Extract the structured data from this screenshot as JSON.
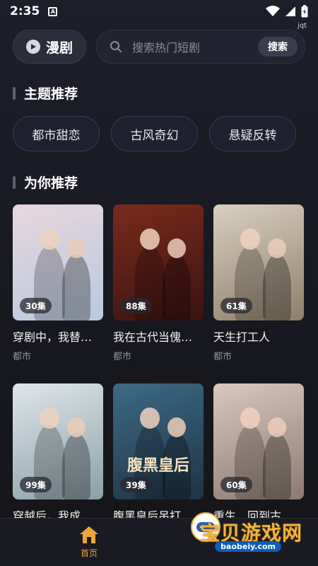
{
  "status": {
    "time": "2:35",
    "app_icon_letter": "A",
    "tag": "jqt"
  },
  "header": {
    "tab_label": "漫剧",
    "search_placeholder": "搜索热门短剧",
    "search_button": "搜索"
  },
  "themes": {
    "title": "主题推荐",
    "items": [
      "都市甜恋",
      "古风奇幻",
      "悬疑反转"
    ]
  },
  "recommend": {
    "title": "为你推荐",
    "items": [
      {
        "episodes": "30集",
        "title": "穿剧中，我替…",
        "tag": "都市",
        "caption": "",
        "palette": [
          "#e7d7de",
          "#b9c9e0"
        ]
      },
      {
        "episodes": "88集",
        "title": "我在古代当傀…",
        "tag": "都市",
        "caption": "",
        "palette": [
          "#7a2a1d",
          "#3a1410"
        ]
      },
      {
        "episodes": "61集",
        "title": "天生打工人",
        "tag": "都市",
        "caption": "",
        "palette": [
          "#d9cfbf",
          "#8f7f6a"
        ]
      },
      {
        "episodes": "99集",
        "title": "穿越后，我成…",
        "tag": "",
        "caption": "",
        "palette": [
          "#dfe6ea",
          "#8aa0a8"
        ]
      },
      {
        "episodes": "39集",
        "title": "腹黑皇后吊打…",
        "tag": "",
        "caption": "腹黑皇后",
        "palette": [
          "#3d6b84",
          "#1e3346"
        ]
      },
      {
        "episodes": "60集",
        "title": "重生…回到古…",
        "tag": "",
        "caption": "",
        "palette": [
          "#d9c8bd",
          "#8c7a72"
        ]
      }
    ]
  },
  "nav": {
    "home_label": "首页"
  },
  "watermark": {
    "text": "宝贝游戏网",
    "url": "baobeiy.com"
  },
  "colors": {
    "accent": "#f0a437",
    "background": "#1d1f2b"
  }
}
